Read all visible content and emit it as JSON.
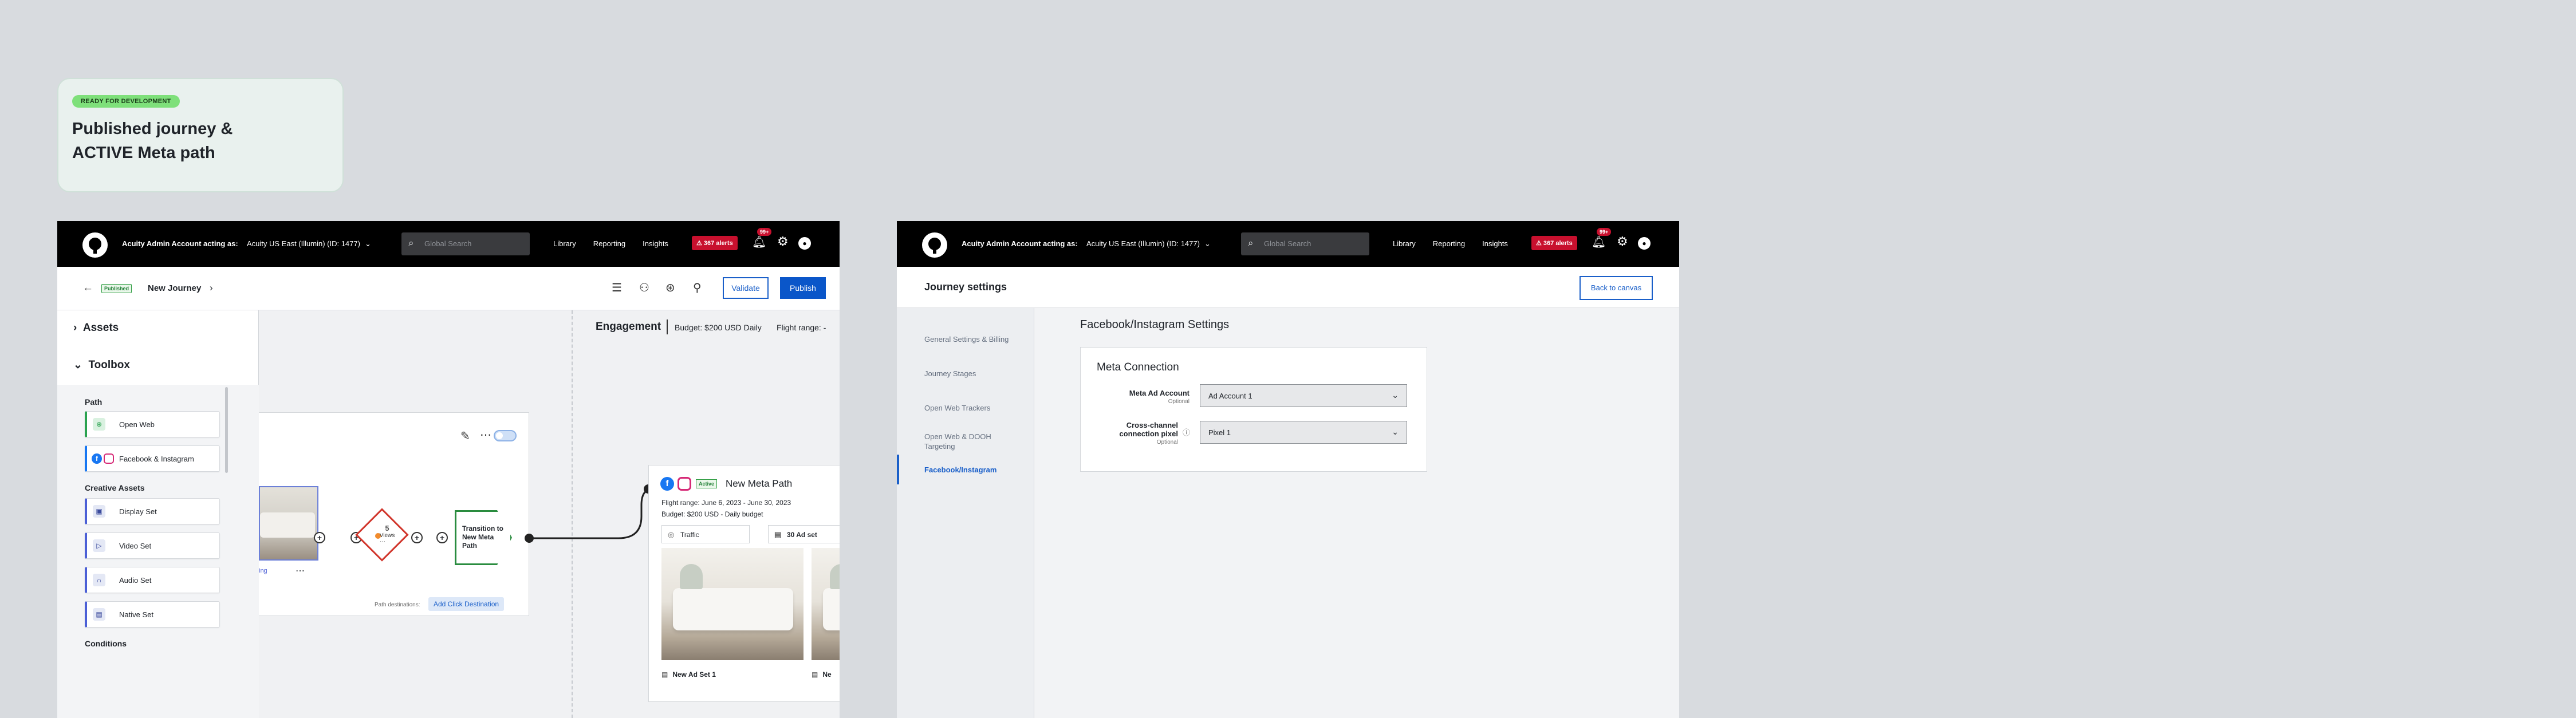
{
  "note": {
    "badge": "READY FOR DEVELOPMENT",
    "title_line1": "Published journey &",
    "title_line2": "ACTIVE Meta path"
  },
  "nav": {
    "acting_label": "Acuity Admin Account acting as:",
    "account": "Acuity US East (Illumin) (ID: 1477)",
    "search_placeholder": "Global Search",
    "links": [
      "Library",
      "Reporting",
      "Insights"
    ],
    "alerts": "367 alerts",
    "bell_badge": "99+"
  },
  "journey": {
    "status": "Published",
    "name": "New Journey",
    "validate": "Validate",
    "publish": "Publish"
  },
  "toolbox": {
    "assets": "Assets",
    "title": "Toolbox",
    "path_section": "Path",
    "path_items": [
      "Open Web",
      "Facebook & Instagram"
    ],
    "creative_section": "Creative Assets",
    "creative_items": [
      "Display Set",
      "Video Set",
      "Audio Set",
      "Native Set"
    ],
    "conditions": "Conditions"
  },
  "engagement": {
    "title": "Engagement",
    "budget": "Budget: $200 USD Daily",
    "flight": "Flight range: -"
  },
  "pathcard": {
    "tag": "ing",
    "views_count": "5",
    "views_label": "Views",
    "transition": "Transition to New Meta Path",
    "dest_label": "Path destinations:",
    "add_click": "Add Click Destination"
  },
  "meta_card": {
    "status": "Active",
    "name": "New Meta Path",
    "flight": "Flight range: June 6, 2023 - June 30, 2023",
    "budget": "Budget: $200 USD - Daily budget",
    "objective": "Traffic",
    "ad_sets": "30 Ad set",
    "ad_set_1": "New Ad Set 1",
    "ad_set_2": "Ne"
  },
  "settings": {
    "title": "Journey settings",
    "back": "Back to canvas",
    "sidebar": [
      "General Settings & Billing",
      "Journey Stages",
      "Open Web Trackers",
      "Open Web & DOOH Targeting",
      "Facebook/Instagram"
    ],
    "heading": "Facebook/Instagram Settings",
    "card_title": "Meta Connection",
    "ad_account_label": "Meta Ad Account",
    "optional": "Optional",
    "ad_account_value": "Ad Account 1",
    "pixel_label_1": "Cross-channel",
    "pixel_label_2": "connection pixel",
    "pixel_value": "Pixel 1"
  },
  "colors": {
    "accent": "#0a56c9",
    "alert": "#c8102e",
    "active": "#2a8c3f"
  },
  "icons": [
    "search-icon",
    "bell-icon",
    "gear-icon",
    "chevron-down-icon",
    "back-arrow-icon",
    "pencil-icon",
    "more-icon"
  ]
}
